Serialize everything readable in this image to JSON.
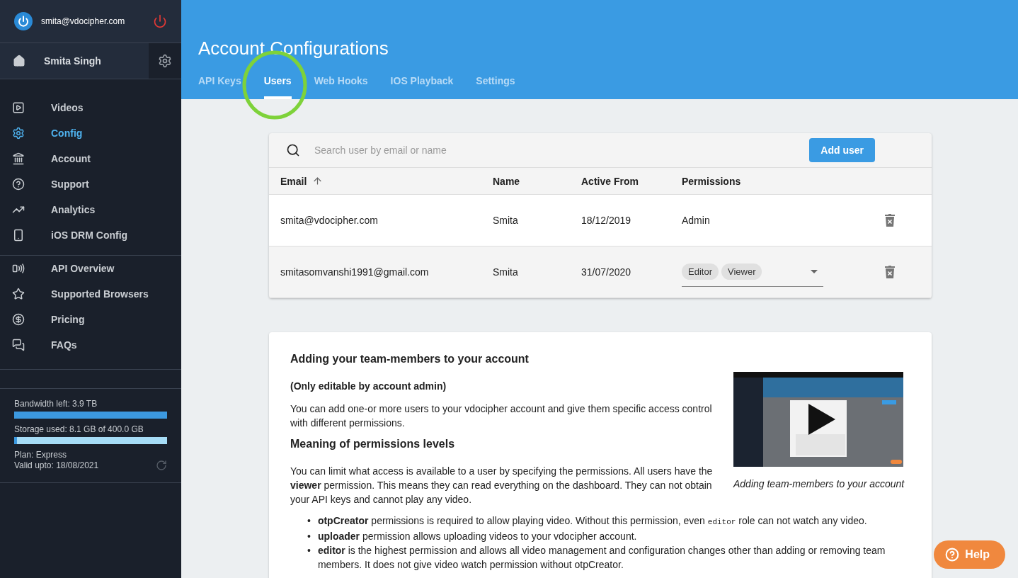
{
  "sidebar": {
    "account_email": "smita@vdocipher.com",
    "user_name": "Smita Singh",
    "nav_groups": [
      [
        {
          "label": "Videos",
          "selected": false
        },
        {
          "label": "Config",
          "selected": true
        },
        {
          "label": "Account",
          "selected": false
        },
        {
          "label": "Support",
          "selected": false
        },
        {
          "label": "Analytics",
          "selected": false
        },
        {
          "label": "iOS DRM Config",
          "selected": false
        }
      ],
      [
        {
          "label": "API Overview",
          "selected": false
        },
        {
          "label": "Supported Browsers",
          "selected": false
        },
        {
          "label": "Pricing",
          "selected": false
        },
        {
          "label": "FAQs",
          "selected": false
        }
      ]
    ],
    "usage": [
      {
        "label": "Bandwidth left: 3.9 TB",
        "level": 1.0
      },
      {
        "label": "Storage used: 8.1 GB of 400.0 GB",
        "level": 0.02
      }
    ],
    "plan": "Plan: Express",
    "valid_upto": "Valid upto: 18/08/2021"
  },
  "header": {
    "title": "Account Configurations",
    "tabs": [
      {
        "label": "API Keys",
        "selected": false
      },
      {
        "label": "Users",
        "selected": true
      },
      {
        "label": "Web Hooks",
        "selected": false
      },
      {
        "label": "IOS Playback",
        "selected": false
      },
      {
        "label": "Settings",
        "selected": false
      }
    ]
  },
  "users_table": {
    "search": {
      "placeholder": "Search user by email or name"
    },
    "add_button": "Add user",
    "columns": [
      "Email",
      "Name",
      "Active From",
      "Permissions"
    ],
    "rows": [
      {
        "email": "smita@vdocipher.com",
        "name": "Smita",
        "active_from": "18/12/2019",
        "kind": "text",
        "permissions": [
          "Admin"
        ]
      },
      {
        "email": "smitasomvanshi1991@gmail.com",
        "name": "Smita",
        "active_from": "31/07/2020",
        "kind": "chips",
        "permissions": [
          "Editor",
          "Viewer"
        ]
      }
    ]
  },
  "help_card": {
    "title": "Adding your team-members to your account",
    "note": "(Only editable by account admin)",
    "intro": "You can add one-or more users to your vdocipher account and give them specific access control with different permissions.",
    "subtitle": "Meaning of permissions levels",
    "paragraph": "You can limit what access is available to a user by specifying the permissions. All users have the **viewer** permission. This means they can read everything on the dashboard. They can not obtain your API keys and cannot play any video.",
    "video": {
      "kind": "picture",
      "caption": "Adding team-members to your account"
    },
    "bullets": [
      {
        "marker": "•",
        "segments": [
          {
            "kind": "bold",
            "text": "otpCreator"
          },
          {
            "kind": "plain",
            "text": " permissions is required to allow playing video. Without this permission, even "
          },
          {
            "kind": "code",
            "text": "editor"
          },
          {
            "kind": "plain",
            "text": " role can not watch any video."
          }
        ]
      },
      {
        "marker": "•",
        "segments": [
          {
            "kind": "bold",
            "text": "uploader"
          },
          {
            "kind": "plain",
            "text": " permission allows uploading videos to your vdocipher account."
          }
        ]
      },
      {
        "marker": "•",
        "segments": [
          {
            "kind": "bold",
            "text": "editor"
          },
          {
            "kind": "plain",
            "text": " is the highest permission and allows all video management and configuration changes other than adding or removing team members. It does not give video watch permission without otpCreator."
          }
        ]
      }
    ]
  },
  "help_button": "Help"
}
